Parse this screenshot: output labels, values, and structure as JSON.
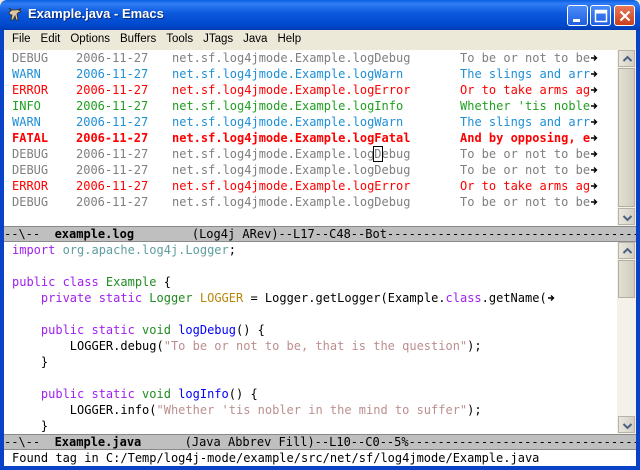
{
  "window": {
    "title": "Example.java - Emacs"
  },
  "menu": [
    "File",
    "Edit",
    "Options",
    "Buffers",
    "Tools",
    "JTags",
    "Java",
    "Help"
  ],
  "log_pane": {
    "lines": [
      {
        "level": "DEBUG",
        "date": "2006-11-27",
        "logger": "net.sf.log4jmode.Example.logDebug",
        "message": "To be or not to be",
        "style": "debug"
      },
      {
        "level": "WARN",
        "date": "2006-11-27",
        "logger": "net.sf.log4jmode.Example.logWarn",
        "message": "The slings and arr",
        "style": "warn"
      },
      {
        "level": "ERROR",
        "date": "2006-11-27",
        "logger": "net.sf.log4jmode.Example.logError",
        "message": "Or to take arms ag",
        "style": "error"
      },
      {
        "level": "INFO",
        "date": "2006-11-27",
        "logger": "net.sf.log4jmode.Example.logInfo",
        "message": "Whether 'tis noble",
        "style": "info"
      },
      {
        "level": "WARN",
        "date": "2006-11-27",
        "logger": "net.sf.log4jmode.Example.logWarn",
        "message": "The slings and arr",
        "style": "warn"
      },
      {
        "level": "FATAL",
        "date": "2006-11-27",
        "logger": "net.sf.log4jmode.Example.logFatal",
        "message": "And by opposing, e",
        "style": "fatal"
      },
      {
        "level": "DEBUG",
        "date": "2006-11-27",
        "logger": "net.sf.log4jmode.Example.logDebug",
        "message": "To be or not to be",
        "style": "debug"
      },
      {
        "level": "DEBUG",
        "date": "2006-11-27",
        "logger": "net.sf.log4jmode.Example.logDebug",
        "message": "To be or not to be",
        "style": "debug"
      },
      {
        "level": "ERROR",
        "date": "2006-11-27",
        "logger": "net.sf.log4jmode.Example.logError",
        "message": "Or to take arms ag",
        "style": "error"
      },
      {
        "level": "DEBUG",
        "date": "2006-11-27",
        "logger": "net.sf.log4jmode.Example.logDebug",
        "message": "To be or not to be",
        "style": "debug"
      }
    ],
    "cursor_line": 6,
    "cursor_logger_prefix": "net.sf.log4jmode.Example.log",
    "cursor_char": "D",
    "cursor_logger_suffix": "ebug"
  },
  "modeline_top": {
    "prefix": "--\\--  ",
    "buffer": "example.log",
    "rest": "        (Log4j ARev)--L17--C48--Bot-----------------------------------------------"
  },
  "code_pane": {
    "lines": [
      [
        {
          "t": "import ",
          "c": "kw"
        },
        {
          "t": "org.apache.log4j.Logger",
          "c": "ref"
        },
        {
          "t": ";",
          "c": "plain"
        }
      ],
      [],
      [
        {
          "t": "public class ",
          "c": "kw"
        },
        {
          "t": "Example",
          "c": "type"
        },
        {
          "t": " {",
          "c": "plain"
        }
      ],
      [
        {
          "t": "    private static ",
          "c": "kw"
        },
        {
          "t": "Logger",
          "c": "type"
        },
        {
          "t": " ",
          "c": "plain"
        },
        {
          "t": "LOGGER",
          "c": "const"
        },
        {
          "t": " = Logger.getLogger(Example.",
          "c": "plain"
        },
        {
          "t": "class",
          "c": "kw"
        },
        {
          "t": ".getName(",
          "c": "plain"
        }
      ],
      [],
      [
        {
          "t": "    public static ",
          "c": "kw"
        },
        {
          "t": "void",
          "c": "type"
        },
        {
          "t": " ",
          "c": "plain"
        },
        {
          "t": "logDebug",
          "c": "fn"
        },
        {
          "t": "() {",
          "c": "plain"
        }
      ],
      [
        {
          "t": "        LOGGER.debug(",
          "c": "plain"
        },
        {
          "t": "\"To be or not to be, that is the question\"",
          "c": "str"
        },
        {
          "t": ");",
          "c": "plain"
        }
      ],
      [
        {
          "t": "    }",
          "c": "plain"
        }
      ],
      [],
      [
        {
          "t": "    public static ",
          "c": "kw"
        },
        {
          "t": "void",
          "c": "type"
        },
        {
          "t": " ",
          "c": "plain"
        },
        {
          "t": "logInfo",
          "c": "fn"
        },
        {
          "t": "() {",
          "c": "plain"
        }
      ],
      [
        {
          "t": "        LOGGER.info(",
          "c": "plain"
        },
        {
          "t": "\"Whether 'tis nobler in the mind to suffer\"",
          "c": "str"
        },
        {
          "t": ");",
          "c": "plain"
        }
      ],
      [
        {
          "t": "    }",
          "c": "plain"
        }
      ]
    ],
    "truncated_lines": [
      3
    ]
  },
  "modeline_bottom": {
    "prefix": "--\\--  ",
    "buffer": "Example.java",
    "rest": "      (Java Abbrev Fill)--L10--C0--5%------------------------------------------"
  },
  "echo_area": {
    "message": "Found tag in C:/Temp/log4j-mode/example/src/net/sf/log4jmode/Example.java"
  },
  "colors": {
    "debug": "#7f7f7f",
    "warn": "#1e90d8",
    "error": "#ff0000",
    "info": "#20a020",
    "fatal": "#ff0000",
    "titlebar": "#0a58dc"
  },
  "icons": [
    "emacs-gnu-icon",
    "minimize-icon",
    "maximize-icon",
    "close-icon",
    "scroll-up-arrow-icon",
    "scroll-down-arrow-icon",
    "line-wrap-arrow-icon"
  ]
}
